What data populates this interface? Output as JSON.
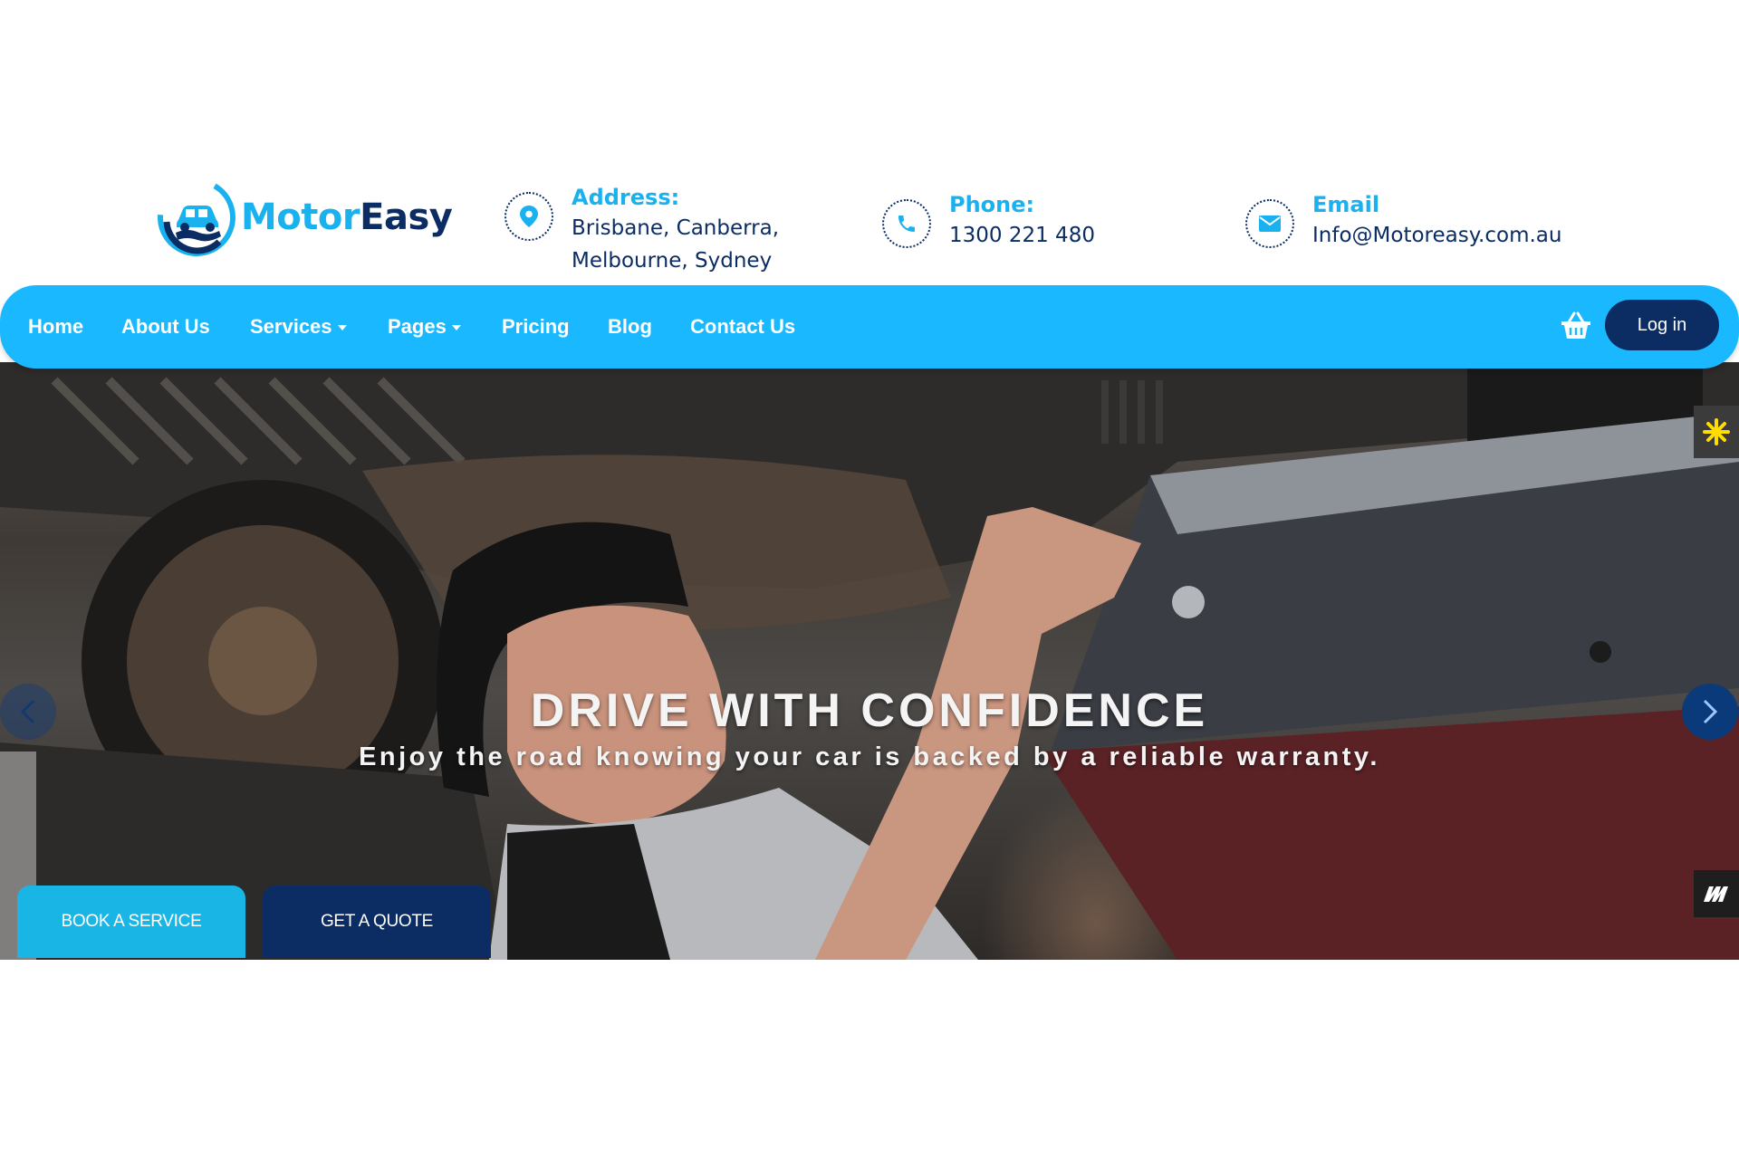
{
  "brand": {
    "name_part1": "Motor",
    "name_part2": "Easy"
  },
  "contact": {
    "address": {
      "title": "Address:",
      "line1": "Brisbane, Canberra,",
      "line2": "Melbourne, Sydney",
      "icon": "map-pin-icon"
    },
    "phone": {
      "title": "Phone:",
      "value": "1300 221 480",
      "icon": "phone-icon"
    },
    "email": {
      "title": "Email",
      "value": "Info@Motoreasy.com.au",
      "icon": "envelope-icon"
    }
  },
  "nav": {
    "items": [
      {
        "label": "Home"
      },
      {
        "label": "About Us"
      },
      {
        "label": "Services",
        "dropdown": true
      },
      {
        "label": "Pages",
        "dropdown": true
      },
      {
        "label": "Pricing"
      },
      {
        "label": "Blog"
      },
      {
        "label": "Contact Us"
      }
    ],
    "cart_icon": "shopping-basket-icon",
    "login_label": "Log in"
  },
  "hero": {
    "headline": "DRIVE WITH CONFIDENCE",
    "subheadline": "Enjoy the road knowing your car is backed by a reliable warranty.",
    "cta_primary": "BOOK A SERVICE",
    "cta_secondary": "GET A QUOTE"
  },
  "colors": {
    "accent": "#1ab8ff",
    "navy": "#0b2d63",
    "cta_primary": "#19b6e5"
  }
}
